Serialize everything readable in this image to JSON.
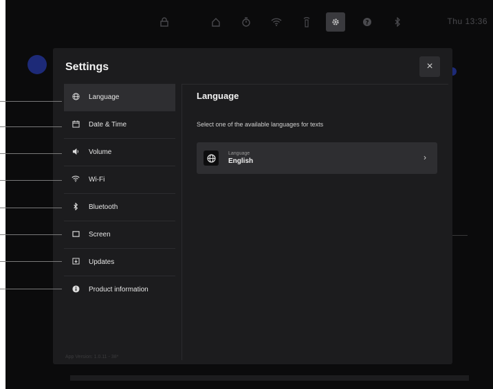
{
  "statusbar": {
    "clock": "Thu 13:36",
    "icons": [
      "lock-icon",
      "home-icon",
      "timer-icon",
      "wifi-icon",
      "remote-icon",
      "gear-icon",
      "help-icon",
      "bluetooth-icon"
    ]
  },
  "modal": {
    "title": "Settings",
    "close_label": "×",
    "app_version": "App Version: 1.0.11 - 38*"
  },
  "nav": {
    "items": [
      {
        "label": "Language",
        "icon": "globe-icon",
        "glyph": "🌐"
      },
      {
        "label": "Date & Time",
        "icon": "calendar-icon",
        "glyph": "▭"
      },
      {
        "label": "Volume",
        "icon": "speaker-icon",
        "glyph": "◂"
      },
      {
        "label": "Wi-Fi",
        "icon": "wifi-icon",
        "glyph": "≋"
      },
      {
        "label": "Bluetooth",
        "icon": "bluetooth-icon",
        "glyph": "ᛒ"
      },
      {
        "label": "Screen",
        "icon": "screen-icon",
        "glyph": "▭"
      },
      {
        "label": "Updates",
        "icon": "updates-icon",
        "glyph": "⊡"
      },
      {
        "label": "Product information",
        "icon": "info-icon",
        "glyph": "●"
      }
    ],
    "selected": "Language"
  },
  "content": {
    "title": "Language",
    "description": "Select one of the available languages for texts",
    "setting": {
      "label": "Language",
      "value": "English",
      "chevron": "›"
    }
  },
  "colors": {
    "background": "#0b0b0c",
    "modal": "#1c1c1e",
    "selected": "#2e2e31",
    "accent_blue": "#1d2a78"
  }
}
